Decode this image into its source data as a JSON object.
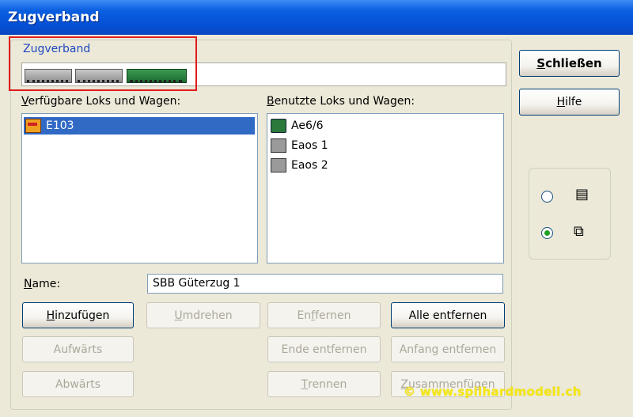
{
  "window": {
    "title": "Zugverband"
  },
  "composition": {
    "legend": "Zugverband",
    "train": [
      {
        "type": "freight-wagon",
        "icon": "wagon-icon"
      },
      {
        "type": "freight-wagon",
        "icon": "wagon-icon"
      },
      {
        "type": "locomotive",
        "icon": "locomotive-icon"
      }
    ]
  },
  "available": {
    "label": "Verfügbare Loks und Wagen:",
    "items": [
      {
        "label": "E103",
        "icon": "tram-icon",
        "selected": true
      }
    ]
  },
  "used": {
    "label": "Benutzte Loks und Wagen:",
    "items": [
      {
        "label": "Ae6/6",
        "icon": "locomotive-icon"
      },
      {
        "label": "Eaos 1",
        "icon": "wagon-icon"
      },
      {
        "label": "Eaos 2",
        "icon": "wagon-icon"
      }
    ]
  },
  "name": {
    "label": "Name:",
    "value": "SBB Güterzug 1"
  },
  "buttons": {
    "add": "Hinzufügen",
    "reverse": "Umdrehen",
    "remove": "Entfernen",
    "remove_all": "Alle entfernen",
    "up": "Aufwärts",
    "remove_end": "Ende entfernen",
    "remove_start": "Anfang entfernen",
    "down": "Abwärts",
    "split": "Trennen",
    "merge": "Zusammenfügen",
    "close": "Schließen",
    "help": "Hilfe"
  },
  "view_options": [
    {
      "icon": "list-view-icon",
      "selected": false
    },
    {
      "icon": "tile-view-icon",
      "selected": true
    }
  ],
  "watermark": "© www.spilhardmodell.ch",
  "colors": {
    "title_bar": "#0551d6",
    "selection": "#316ac5",
    "highlight_frame": "#e01b1b",
    "watermark": "#f5e800"
  }
}
